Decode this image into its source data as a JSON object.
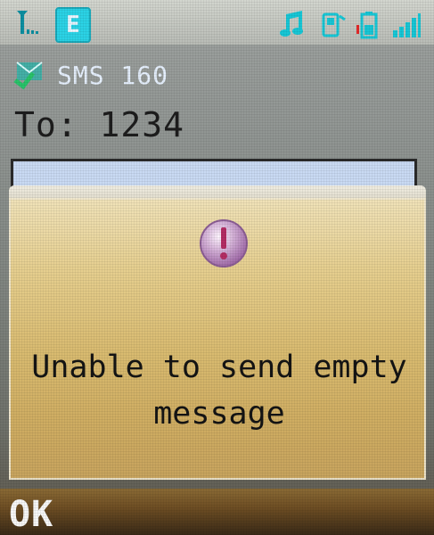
{
  "status_bar": {
    "network_badge": "E",
    "icons": {
      "signal_antenna": "signal-antenna-icon",
      "music": "music-note-icon",
      "phone": "phone-icon",
      "battery": "battery-icon",
      "signal_strength": "signal-strength-icon"
    }
  },
  "header": {
    "sms_icon": "sms-icon",
    "sms_label": "SMS 160",
    "to_line": "To: 1234"
  },
  "dialog": {
    "alert_icon": "exclamation-icon",
    "message": "Unable to send empty message"
  },
  "softkeys": {
    "left": "OK"
  },
  "colors": {
    "accent": "#2bd3e6",
    "dialog_gold": "#d9bb70",
    "softkey_brown": "#6f4f24"
  }
}
